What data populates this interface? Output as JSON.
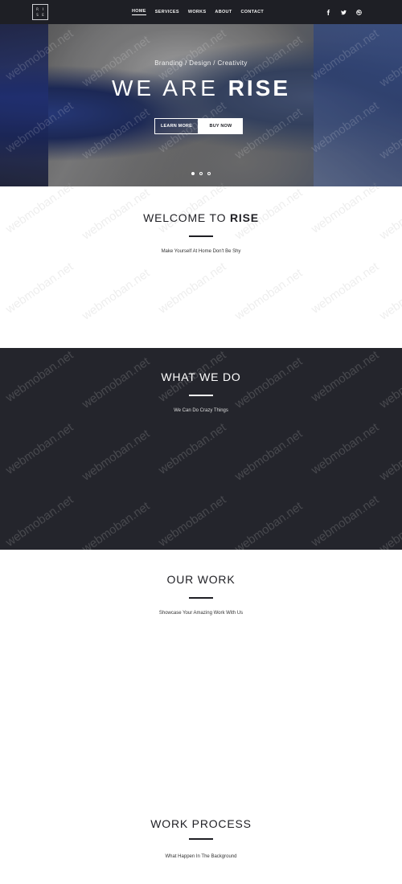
{
  "header": {
    "logo_letters": [
      "R",
      "I",
      "S",
      "E"
    ],
    "nav": [
      {
        "label": "HOME",
        "active": true
      },
      {
        "label": "SERVICES",
        "active": false
      },
      {
        "label": "WORKS",
        "active": false
      },
      {
        "label": "ABOUT",
        "active": false
      },
      {
        "label": "CONTACT",
        "active": false
      }
    ],
    "social_icons": [
      "facebook-icon",
      "twitter-icon",
      "dribbble-icon"
    ]
  },
  "hero": {
    "tagline": "Branding / Design / Creativity",
    "title_light": "WE ARE ",
    "title_bold": "RISE",
    "buttons": {
      "learn_more": "LEARN MORE",
      "buy_now": "BUY NOW"
    },
    "slides": 3,
    "active_slide": 1
  },
  "welcome": {
    "title_light": "WELCOME TO ",
    "title_bold": "RISE",
    "subtitle": "Make Yourself At Home Don't Be Shy"
  },
  "whatwedo": {
    "title": "WHAT WE DO",
    "subtitle": "We Can Do Crazy Things"
  },
  "ourwork": {
    "title": "OUR WORK",
    "subtitle": "Showcase Your Amazing Work With Us"
  },
  "process": {
    "title": "WORK PROCESS",
    "subtitle": "What Happen In The Background"
  },
  "watermark_text": "webmoban.net",
  "colors": {
    "dark": "#1e1f25",
    "section_dark": "#24252c",
    "white": "#ffffff"
  }
}
